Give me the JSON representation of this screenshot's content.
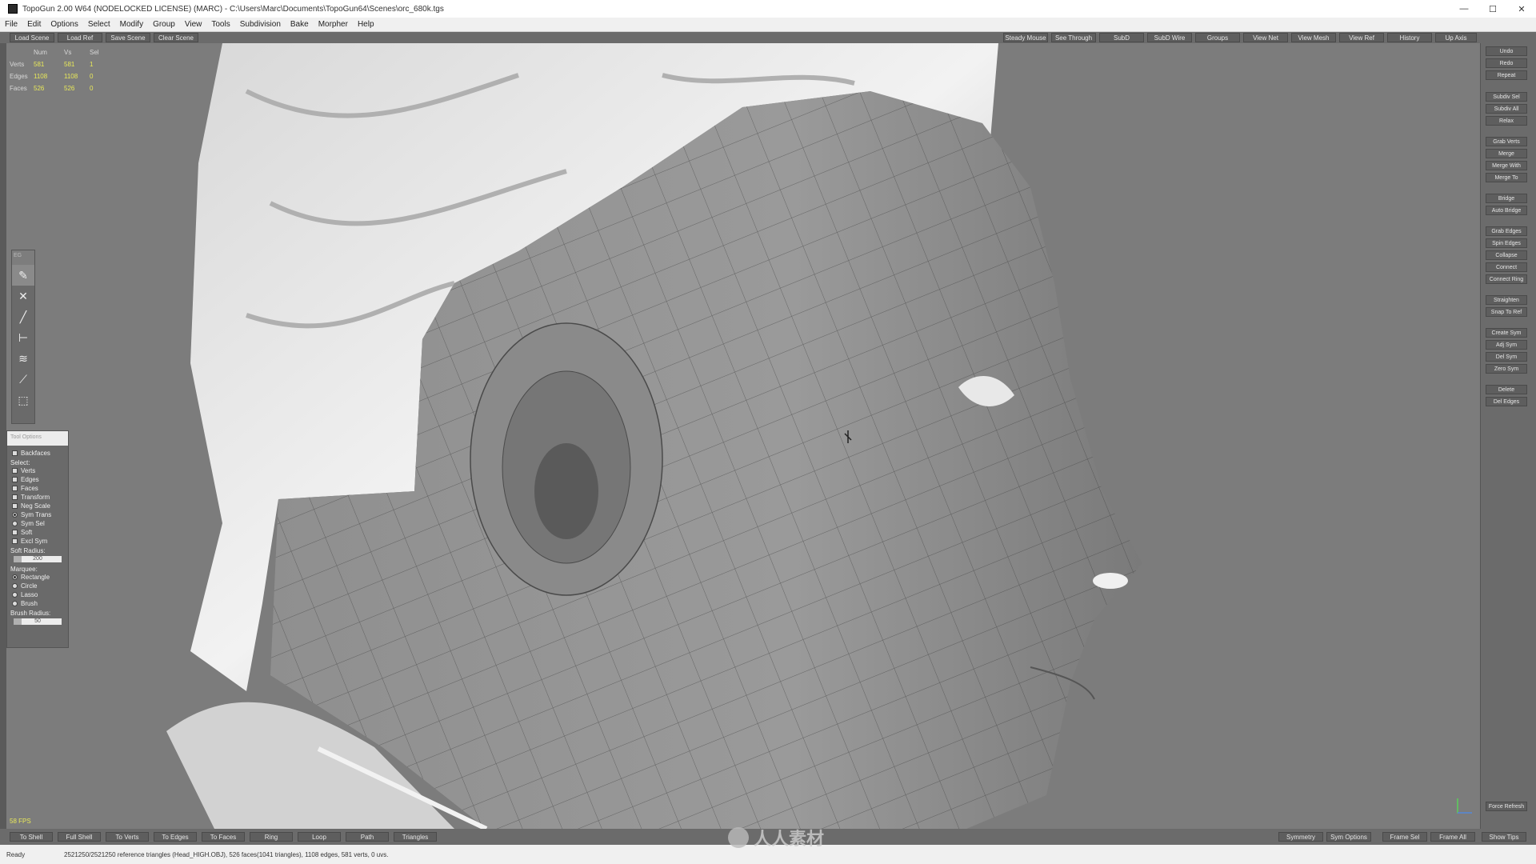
{
  "window": {
    "title": "TopoGun 2.00 W64 (NODELOCKED LICENSE) (MARC) - C:\\Users\\Marc\\Documents\\TopoGun64\\Scenes\\orc_680k.tgs",
    "minimize": "—",
    "maximize": "☐",
    "close": "✕"
  },
  "menu": [
    "File",
    "Edit",
    "Options",
    "Select",
    "Modify",
    "Group",
    "View",
    "Tools",
    "Subdivision",
    "Bake",
    "Morpher",
    "Help"
  ],
  "top_toolbar": {
    "left": [
      "Load Scene",
      "Load Ref",
      "Save Scene",
      "Clear Scene"
    ],
    "right": [
      "Steady Mouse",
      "See Through",
      "SubD",
      "SubD Wire",
      "Groups",
      "View Net",
      "View Mesh",
      "View Ref",
      "History",
      "Up Axis"
    ]
  },
  "stats": {
    "headers": [
      "Num",
      "Vs",
      "Sel"
    ],
    "rows": [
      {
        "label": "Verts",
        "num": "581",
        "vs": "581",
        "sel": "1"
      },
      {
        "label": "Edges",
        "num": "1108",
        "vs": "1108",
        "sel": "0"
      },
      {
        "label": "Faces",
        "num": "526",
        "vs": "526",
        "sel": "0"
      }
    ]
  },
  "tool_palette": {
    "header": "EG",
    "tools": [
      "pick",
      "cut",
      "draw",
      "bridge",
      "brush",
      "paint",
      "marquee"
    ]
  },
  "options_panel": {
    "header": "Tool Options",
    "backfaces": "Backfaces",
    "select_label": "Select:",
    "select_items": [
      "Verts",
      "Edges",
      "Faces"
    ],
    "checks": [
      "Transform",
      "Neg Scale"
    ],
    "radios": [
      "Sym Trans",
      "Sym Sel"
    ],
    "checks2": [
      "Soft",
      "Excl Sym"
    ],
    "soft_radius_label": "Soft Radius:",
    "soft_radius_value": "200",
    "marquee_label": "Marquee:",
    "marquee_items": [
      "Rectangle",
      "Circle",
      "Lasso",
      "Brush"
    ],
    "brush_radius_label": "Brush Radius:",
    "brush_radius_value": "50"
  },
  "fps": "58 FPS",
  "right_panel": {
    "groups": [
      [
        "Undo",
        "Redo",
        "Repeat"
      ],
      [
        "Subdiv Sel",
        "Subdiv All",
        "Relax"
      ],
      [
        "Grab Verts",
        "Merge",
        "Merge With",
        "Merge To"
      ],
      [
        "Bridge",
        "Auto Bridge"
      ],
      [
        "Grab Edges",
        "Spin Edges",
        "Collapse",
        "Connect",
        "Connect Ring"
      ],
      [
        "Straighten",
        "Snap To Ref"
      ],
      [
        "Create Sym",
        "Adj Sym",
        "Del Sym",
        "Zero Sym"
      ],
      [
        "Delete",
        "Del Edges"
      ]
    ],
    "force_refresh": "Force Refresh"
  },
  "bottom_toolbar": {
    "left": [
      "To Shell",
      "Full Shell",
      "To Verts",
      "To Edges",
      "To Faces",
      "Ring",
      "Loop",
      "Path",
      "Triangles"
    ],
    "right": [
      "Symmetry",
      "Sym Options",
      "Frame Sel",
      "Frame All",
      "Show Tips"
    ]
  },
  "status": {
    "ready": "Ready",
    "info": "2521250/2521250 reference triangles (Head_HIGH.OBJ), 526 faces(1041 triangles), 1108 edges, 581 verts, 0 uvs."
  },
  "watermark": "人人素材",
  "colors": {
    "viewport_bg": "#7c7c7c",
    "stat_value": "#e8e85a",
    "panel_bg": "#6b6b6b"
  }
}
